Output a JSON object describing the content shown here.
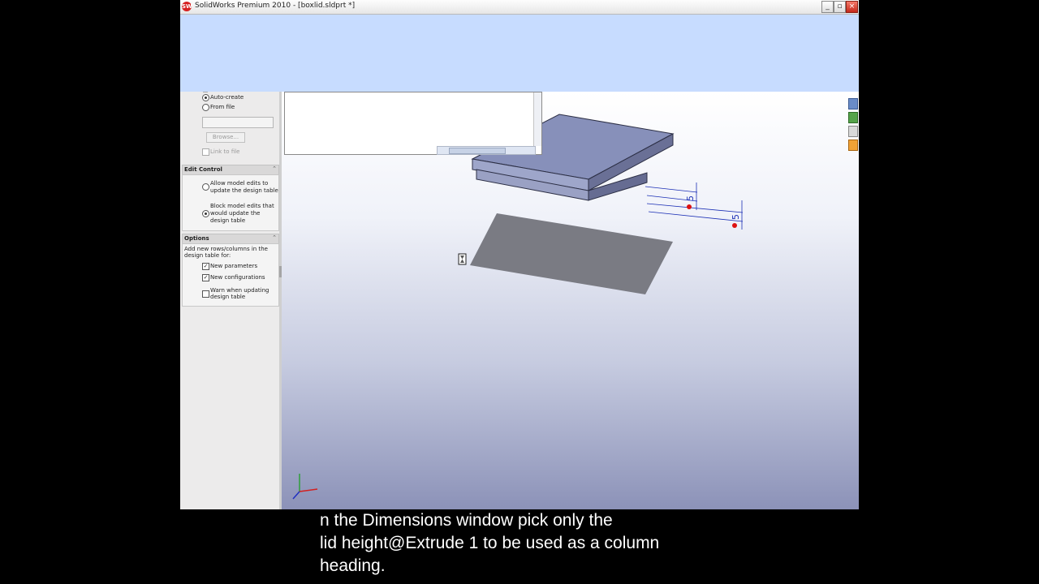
{
  "window": {
    "title": "SolidWorks Premium 2010 - [boxlid.sldprt *]",
    "app_icon_text": "SW",
    "minimize": "_",
    "restore": "▫",
    "close": "×"
  },
  "panel": {
    "source_options": [
      {
        "label": "Auto-create",
        "selected": true
      },
      {
        "label": "From file",
        "selected": false
      }
    ],
    "browse_button": "Browse...",
    "link_to_file": "Link to file",
    "edit_control": {
      "header": "Edit Control",
      "options": [
        {
          "label_lines": [
            "Allow model edits to",
            "update the design table"
          ],
          "selected": false
        },
        {
          "label_lines": [
            "Block model edits that",
            "would update the",
            "design table"
          ],
          "selected": true
        }
      ]
    },
    "options_section": {
      "header": "Options",
      "description_lines": [
        "Add new rows/columns in the",
        "design table for:"
      ],
      "checkboxes": [
        {
          "label_lines": [
            "New parameters"
          ],
          "checked": true
        },
        {
          "label_lines": [
            "New configurations"
          ],
          "checked": true
        },
        {
          "label_lines": [
            "Warn when updating",
            "design table"
          ],
          "checked": false
        }
      ]
    }
  },
  "viewport": {
    "dimension_labels": [
      "5",
      "5"
    ],
    "cursor_icon": "hourglass-cursor"
  },
  "subtitle": {
    "lines": [
      "n the Dimensions window pick only the",
      "lid height@Extrude 1 to be used as a column",
      "heading."
    ]
  },
  "colors": {
    "ribbon": "#c7dcff",
    "panel": "#ecebeb",
    "dimension": "#1b2fb5",
    "lid_face": "#8790ba"
  }
}
